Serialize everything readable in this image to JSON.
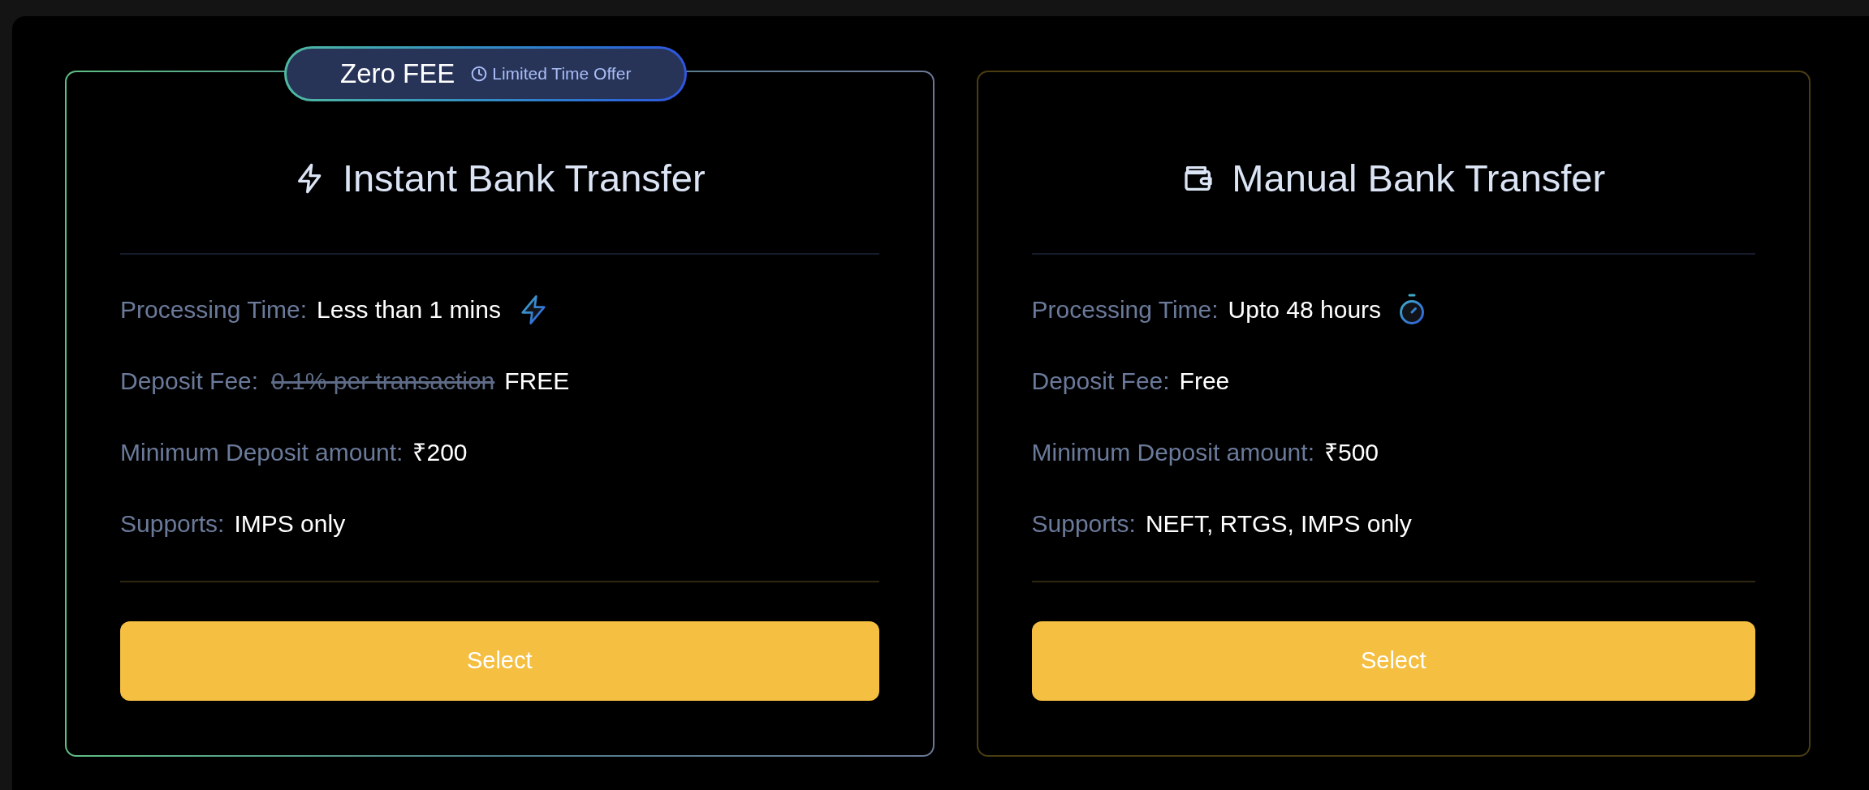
{
  "cards": [
    {
      "title": "Instant Bank Transfer",
      "kind": "instant",
      "highlighted": true,
      "badge": {
        "title": "Zero FEE",
        "note": "Limited Time Offer"
      },
      "rows": [
        {
          "kind": "time",
          "label": "Processing Time:",
          "value": "Less than 1 mins"
        },
        {
          "kind": "fee",
          "label": "Deposit Fee:",
          "old_value": "0.1% per transaction",
          "value": "FREE"
        },
        {
          "kind": "plain",
          "label": "Minimum Deposit amount:",
          "value": "₹200"
        },
        {
          "kind": "plain",
          "label": "Supports:",
          "value": "IMPS only"
        }
      ],
      "button": "Select"
    },
    {
      "title": "Manual Bank Transfer",
      "kind": "manual",
      "highlighted": false,
      "rows": [
        {
          "kind": "time",
          "label": "Processing Time:",
          "value": "Upto 48 hours"
        },
        {
          "kind": "fee",
          "label": "Deposit Fee:",
          "value": "Free"
        },
        {
          "kind": "plain",
          "label": "Minimum Deposit amount:",
          "value": "₹500"
        },
        {
          "kind": "plain",
          "label": "Supports:",
          "value": "NEFT, RTGS, IMPS only"
        }
      ],
      "button": "Select"
    }
  ]
}
